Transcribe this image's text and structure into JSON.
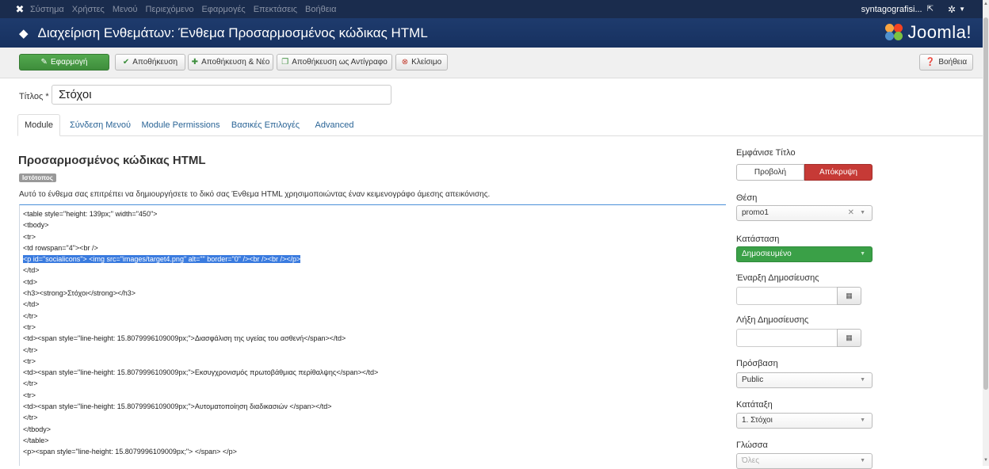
{
  "topnav": {
    "logo_icon": "joomla-x-icon",
    "menu": [
      "Σύστημα",
      "Χρήστες",
      "Μενού",
      "Περιεχόμενο",
      "Εφαρμογές",
      "Επεκτάσεις",
      "Βοήθεια"
    ],
    "site_name": "syntagografisi...",
    "external_icon": "↗",
    "settings_icon": "gear-icon"
  },
  "header": {
    "title": "Διαχείριση Ενθεμάτων: Ένθεμα Προσαρμοσμένος κώδικας HTML",
    "brand": "Joomla!"
  },
  "toolbar": {
    "apply": "Εφαρμογή",
    "save": "Αποθήκευση",
    "save_new": "Αποθήκευση & Νέο",
    "save_copy": "Αποθήκευση ως Αντίγραφο",
    "close": "Κλείσιμο",
    "help": "Βοήθεια"
  },
  "title_field": {
    "label": "Τίτλος *",
    "value": "Στόχοι"
  },
  "tabs": [
    "Module",
    "Σύνδεση Μενού",
    "Module Permissions",
    "Βασικές Επιλογές",
    "Advanced"
  ],
  "module": {
    "heading": "Προσαρμοσμένος κώδικας HTML",
    "badge": "Ιστότοπος",
    "description": "Αυτό το ένθεμα σας επιτρέπει να δημιουργήσετε το δικό σας Ένθεμα HTML χρησιμοποιώντας έναν κειμενογράφο άμεσης απεικόνισης."
  },
  "code_lines": [
    "<table style=\"height: 139px;\" width=\"450\">",
    "<tbody>",
    "<tr>",
    "<td rowspan=\"4\"><br />",
    "<p id=\"socialicons\"> <img src=\"images/target4.png\" alt=\"\" border=\"0\" /><br /><br /></p>",
    "</td>",
    "<td>",
    "<h3><strong>Στόχοι</strong></h3>",
    "</td>",
    "</tr>",
    "<tr>",
    "<td><span style=\"line-height: 15.8079996109009px;\">Διασφάλιση της υγείας του ασθενή</span></td>",
    "</tr>",
    "<tr>",
    "<td><span style=\"line-height: 15.8079996109009px;\">Εκσυγχρονισμός πρωτοβάθμιας περίθαλψης</span></td>",
    "</tr>",
    "<tr>",
    "<td><span style=\"line-height: 15.8079996109009px;\">Αυτοματοποίηση διαδικασιών </span></td>",
    "</tr>",
    "</tbody>",
    "</table>",
    "<p><span style=\"line-height: 15.8079996109009px;\"> </span> </p>"
  ],
  "selected_line_index": 4,
  "sidebar": {
    "show_title_label": "Εμφάνισε Τίτλο",
    "show_option": "Προβολή",
    "hide_option": "Απόκρυψη",
    "position_label": "Θέση",
    "position_value": "promo1",
    "status_label": "Κατάσταση",
    "status_value": "Δημοσιευμένο",
    "publish_up_label": "Έναρξη Δημοσίευσης",
    "publish_down_label": "Λήξη Δημοσίευσης",
    "access_label": "Πρόσβαση",
    "access_value": "Public",
    "ordering_label": "Κατάταξη",
    "ordering_value": "1. Στόχοι",
    "language_label": "Γλώσσα",
    "language_value": "Όλες"
  },
  "colors": {
    "navbar": "#1a2c4d",
    "header": "#1e3b6d",
    "apply_green": "#46a046",
    "hide_red": "#c63a36",
    "published_green": "#3aa047",
    "selection_blue": "#3a7bdf"
  }
}
